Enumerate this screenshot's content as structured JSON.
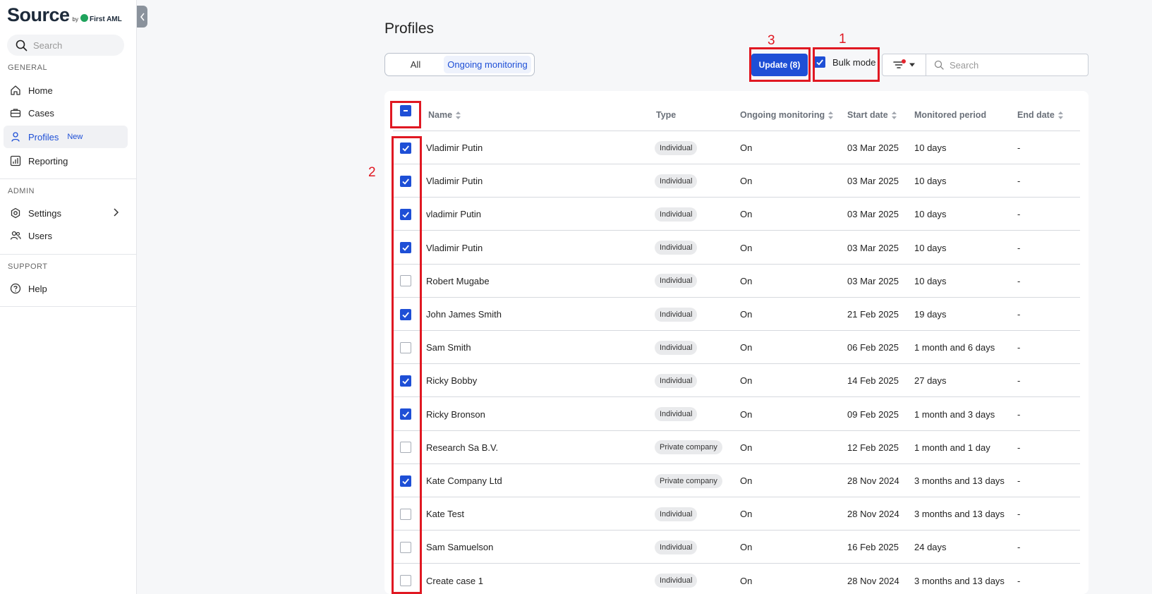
{
  "sidebar": {
    "logo": {
      "word": "Source",
      "by": "by",
      "brand": "First AML"
    },
    "search_placeholder": "Search",
    "sections": {
      "general": "GENERAL",
      "admin": "ADMIN",
      "support": "SUPPORT"
    },
    "items": {
      "home": "Home",
      "cases": "Cases",
      "profiles": "Profiles",
      "profiles_badge": "New",
      "reporting": "Reporting",
      "settings": "Settings",
      "users": "Users",
      "help": "Help"
    }
  },
  "header": {
    "title": "Profiles",
    "tabs": [
      "All",
      "Ongoing monitoring"
    ],
    "active_tab": "Ongoing monitoring",
    "update_button": "Update (8)",
    "bulk_mode_label": "Bulk mode",
    "bulk_mode_checked": true,
    "search_placeholder": "Search"
  },
  "table": {
    "columns": [
      "Name",
      "Type",
      "Ongoing monitoring",
      "Start date",
      "Monitored period",
      "End date"
    ],
    "select_all_state": "indeterminate",
    "rows": [
      {
        "checked": true,
        "name": "Vladimir Putin",
        "type": "Individual",
        "monitoring": "On",
        "start": "03 Mar 2025",
        "period": "10 days",
        "end": "-"
      },
      {
        "checked": true,
        "name": "Vladimir Putin",
        "type": "Individual",
        "monitoring": "On",
        "start": "03 Mar 2025",
        "period": "10 days",
        "end": "-"
      },
      {
        "checked": true,
        "name": "vladimir Putin",
        "type": "Individual",
        "monitoring": "On",
        "start": "03 Mar 2025",
        "period": "10 days",
        "end": "-"
      },
      {
        "checked": true,
        "name": "Vladimir Putin",
        "type": "Individual",
        "monitoring": "On",
        "start": "03 Mar 2025",
        "period": "10 days",
        "end": "-"
      },
      {
        "checked": false,
        "name": "Robert Mugabe",
        "type": "Individual",
        "monitoring": "On",
        "start": "03 Mar 2025",
        "period": "10 days",
        "end": "-"
      },
      {
        "checked": true,
        "name": "John James Smith",
        "type": "Individual",
        "monitoring": "On",
        "start": "21 Feb 2025",
        "period": "19 days",
        "end": "-"
      },
      {
        "checked": false,
        "name": "Sam Smith",
        "type": "Individual",
        "monitoring": "On",
        "start": "06 Feb 2025",
        "period": "1 month and 6 days",
        "end": "-"
      },
      {
        "checked": true,
        "name": "Ricky Bobby",
        "type": "Individual",
        "monitoring": "On",
        "start": "14 Feb 2025",
        "period": "27 days",
        "end": "-"
      },
      {
        "checked": true,
        "name": "Ricky Bronson",
        "type": "Individual",
        "monitoring": "On",
        "start": "09 Feb 2025",
        "period": "1 month and 3 days",
        "end": "-"
      },
      {
        "checked": false,
        "name": "Research Sa B.V.",
        "type": "Private company",
        "monitoring": "On",
        "start": "12 Feb 2025",
        "period": "1 month and 1 day",
        "end": "-"
      },
      {
        "checked": true,
        "name": "Kate Company Ltd",
        "type": "Private company",
        "monitoring": "On",
        "start": "28 Nov 2024",
        "period": "3 months and 13 days",
        "end": "-"
      },
      {
        "checked": false,
        "name": "Kate Test",
        "type": "Individual",
        "monitoring": "On",
        "start": "28 Nov 2024",
        "period": "3 months and 13 days",
        "end": "-"
      },
      {
        "checked": false,
        "name": "Sam Samuelson",
        "type": "Individual",
        "monitoring": "On",
        "start": "16 Feb 2025",
        "period": "24 days",
        "end": "-"
      },
      {
        "checked": false,
        "name": "Create case 1",
        "type": "Individual",
        "monitoring": "On",
        "start": "28 Nov 2024",
        "period": "3 months and 13 days",
        "end": "-"
      }
    ]
  },
  "annotations": {
    "one": "1",
    "two": "2",
    "three": "3"
  },
  "colors": {
    "accent": "#1e4fd6",
    "annotation": "#e01822",
    "filter_dot": "#e3262f"
  },
  "icons": [
    "search-icon",
    "home-icon",
    "briefcase-icon",
    "user-icon",
    "chart-icon",
    "settings-icon",
    "users-icon",
    "help-icon",
    "chevron-right-icon",
    "chevron-left-icon",
    "filter-icon",
    "caret-down-icon",
    "sort-icon",
    "check-icon",
    "minus-icon"
  ]
}
